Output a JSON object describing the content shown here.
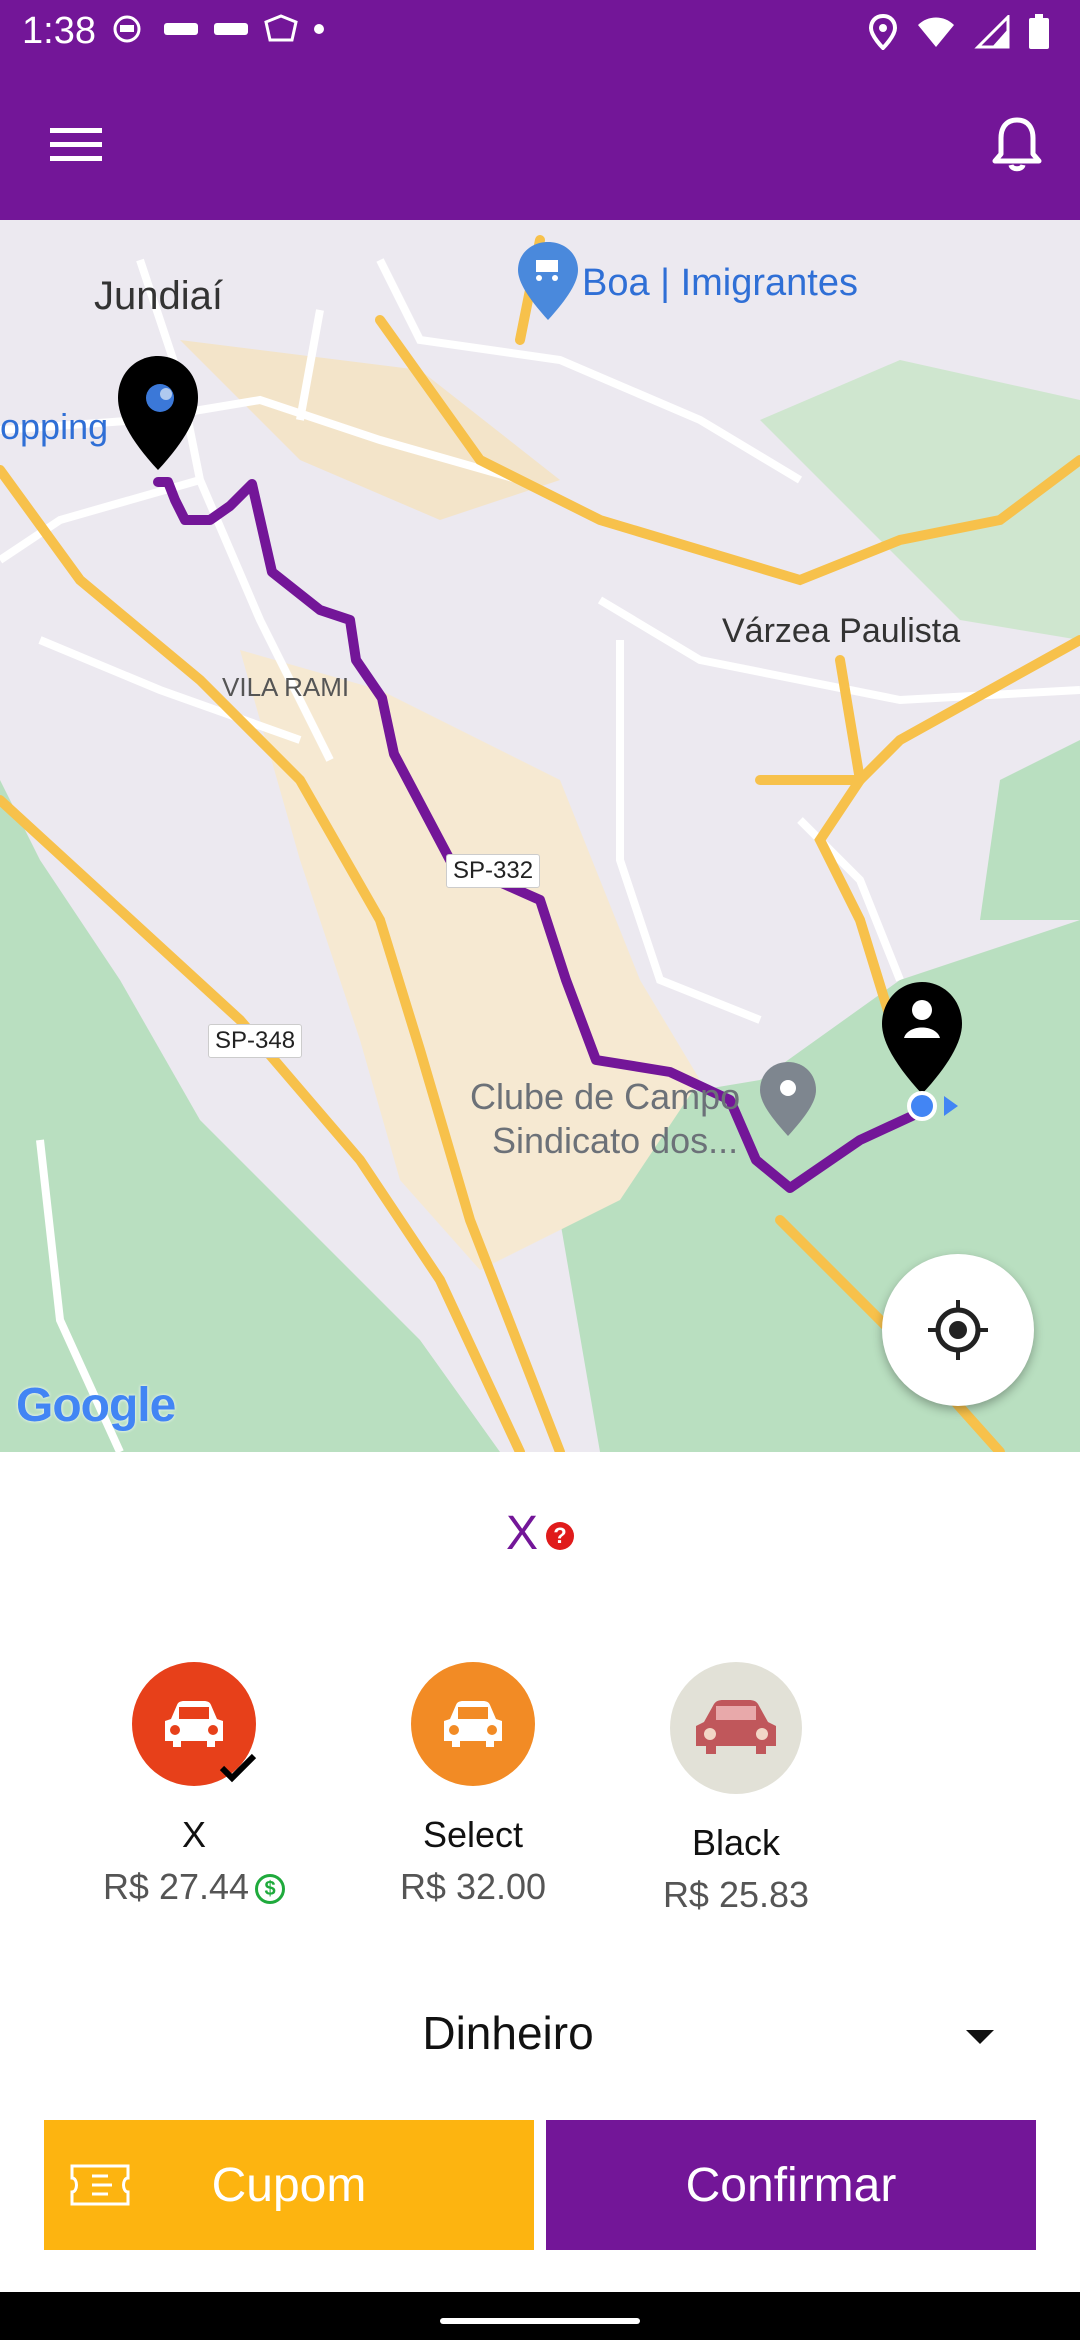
{
  "status_bar": {
    "time": "1:38"
  },
  "map": {
    "labels": {
      "jundiai": "Jundiaí",
      "boa_imigrantes": "Boa | Imigrantes",
      "shopping": "opping",
      "varzea_paulista": "Várzea Paulista",
      "vila_rami": "VILA RAMI",
      "clube_line1": "Clube de Campo",
      "clube_line2": "Sindicato dos..."
    },
    "road_tags": {
      "sp332": "SP-332",
      "sp348": "SP-348"
    },
    "google_logo": "Google",
    "colors": {
      "route": "#731698",
      "road_major": "#f7c14b",
      "green": "#b9dfc0",
      "urban": "#f6e9d2"
    }
  },
  "selection": {
    "title": "X"
  },
  "categories": [
    {
      "name": "X",
      "price": "R$ 27.44",
      "selected": true,
      "color": "#e7401a"
    },
    {
      "name": "Select",
      "price": "R$ 32.00",
      "selected": false,
      "color": "#f28b25"
    },
    {
      "name": "Black",
      "price": "R$ 25.83",
      "selected": false,
      "color": "#e2e1d7"
    }
  ],
  "payment": {
    "method": "Dinheiro"
  },
  "buttons": {
    "coupon": "Cupom",
    "confirm": "Confirmar"
  },
  "colors": {
    "primary": "#731698",
    "coupon": "#fdb410",
    "help": "#e01b1b",
    "money": "#1faa3c"
  }
}
